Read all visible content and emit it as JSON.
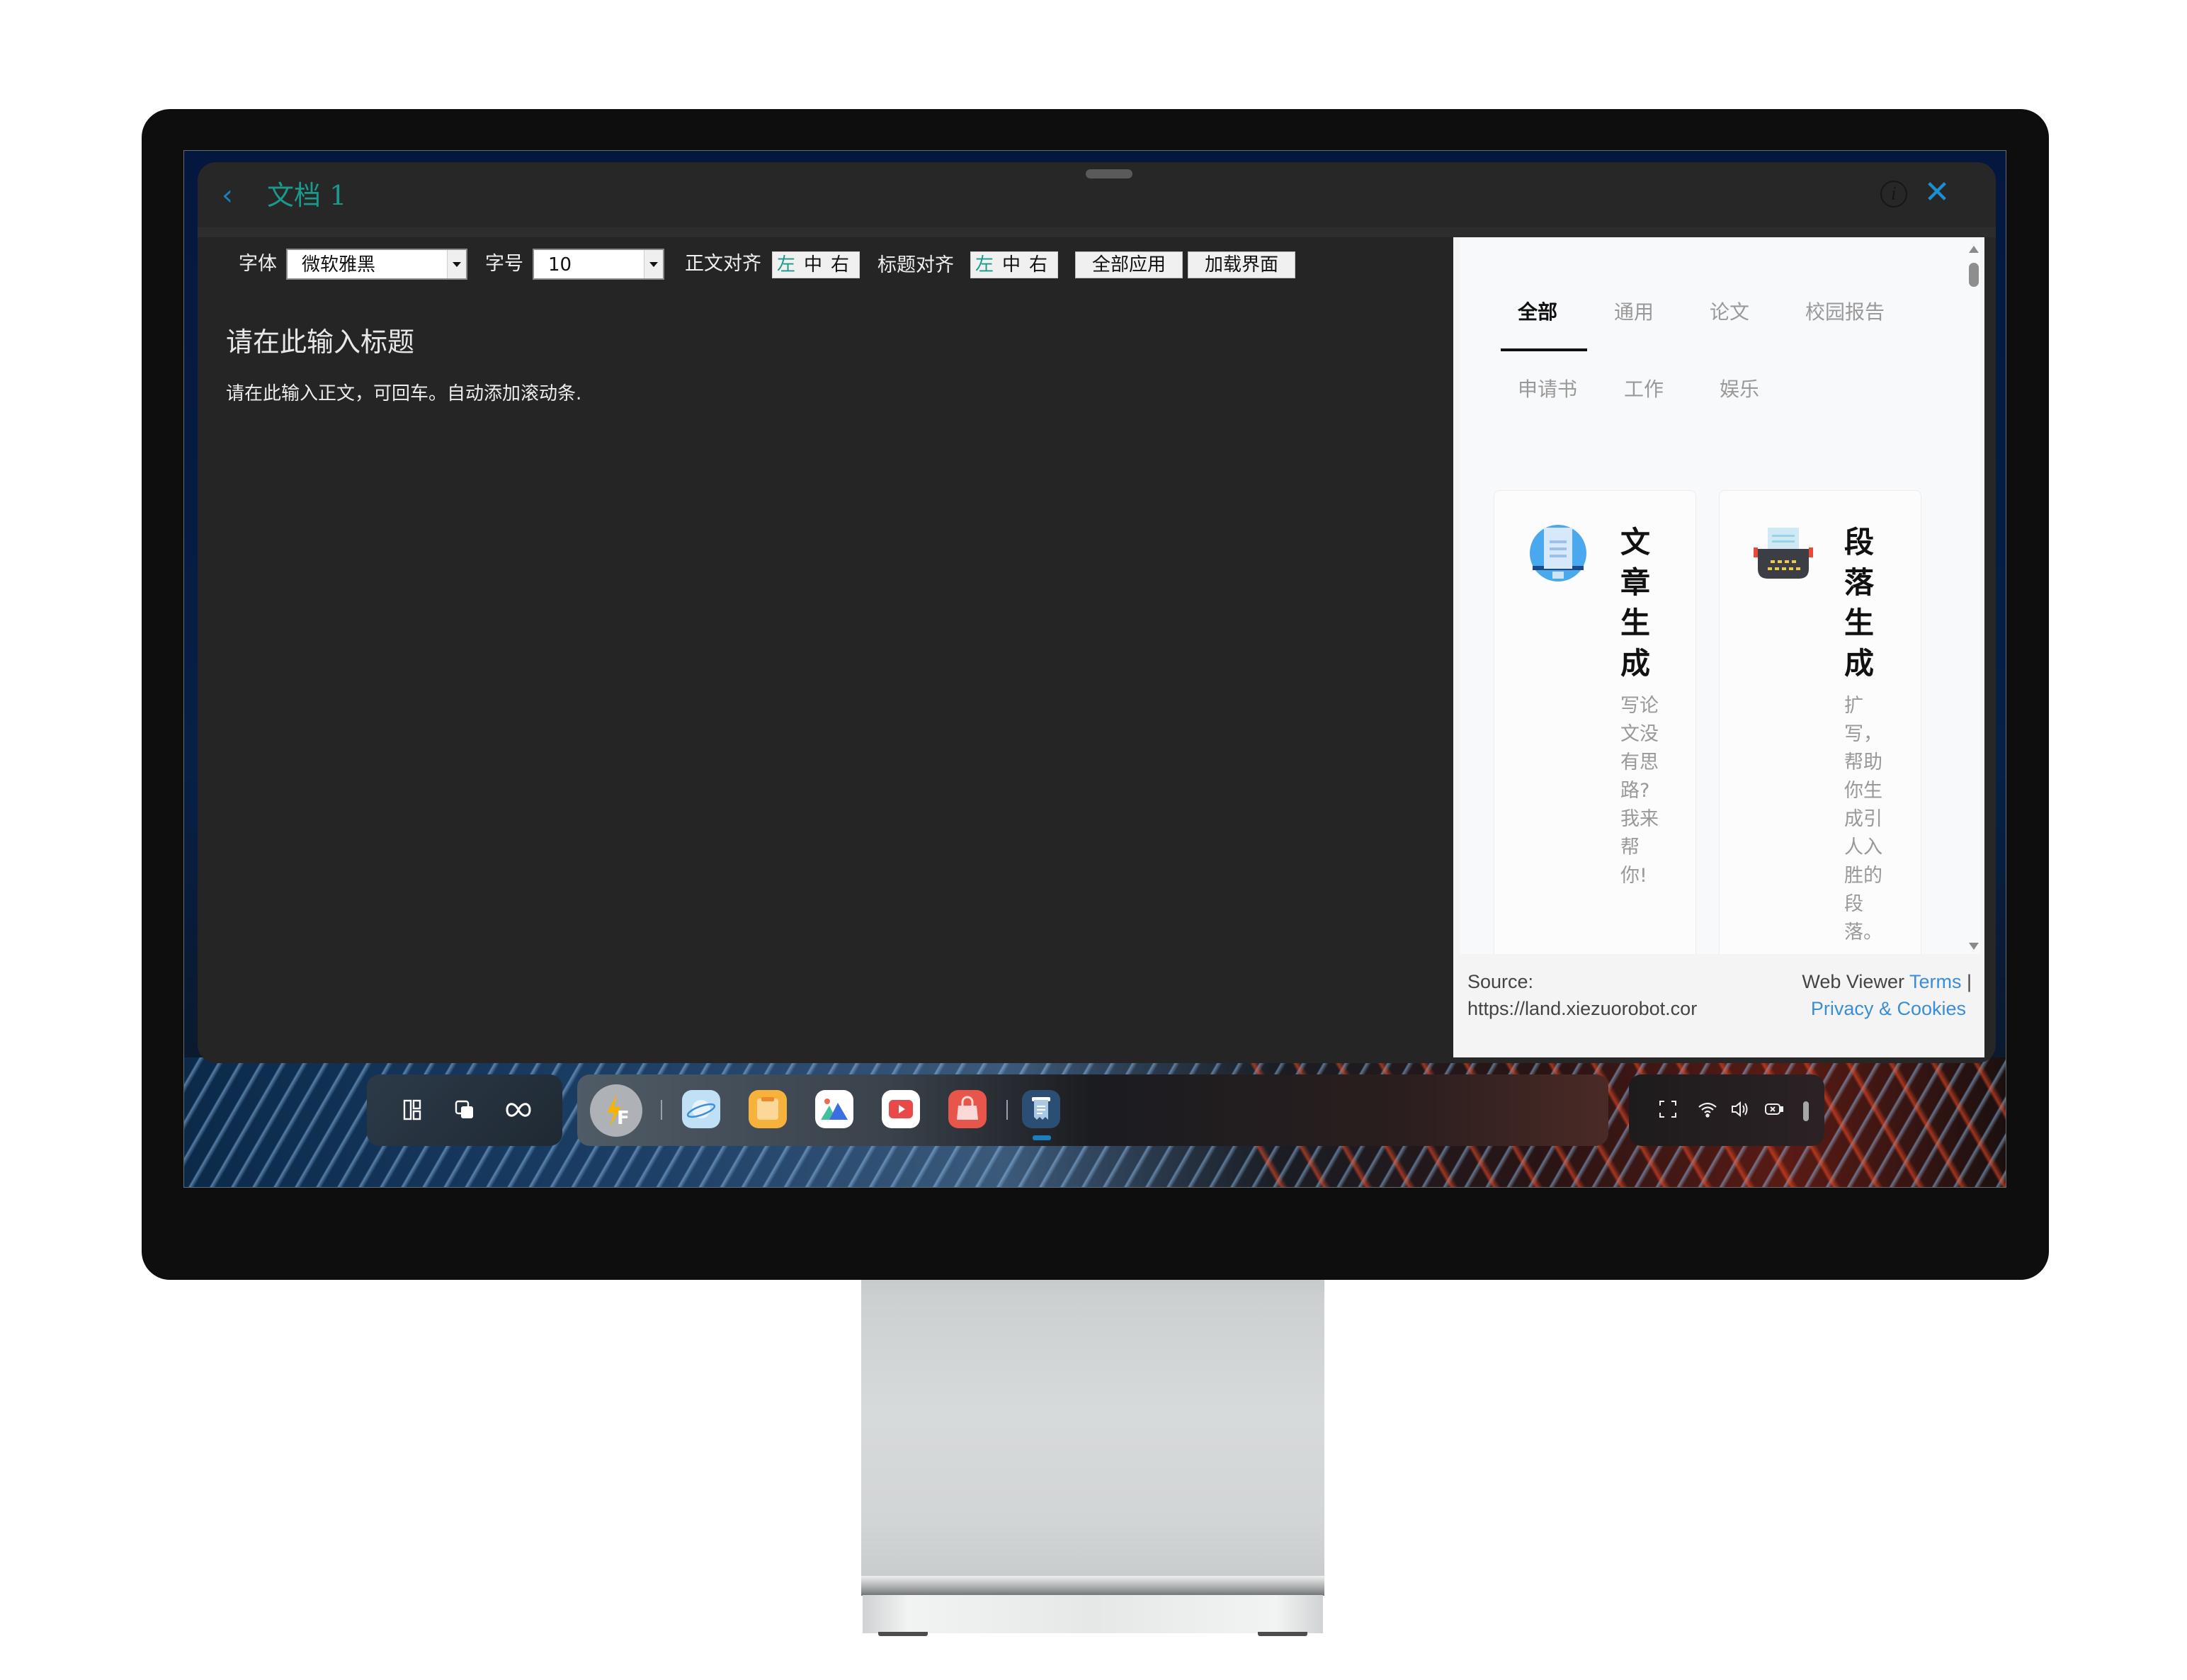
{
  "window": {
    "title": "文档 1",
    "back_icon": "‹",
    "info_icon": "i",
    "close_icon": "✕"
  },
  "toolbar": {
    "font_label": "字体",
    "font_value": "微软雅黑",
    "size_label": "字号",
    "size_value": "10",
    "body_align_label": "正文对齐",
    "title_align_label": "标题对齐",
    "align_options": [
      "左",
      "中",
      "右"
    ],
    "body_align_selected": "左",
    "title_align_selected": "左",
    "apply_all_label": "全部应用",
    "load_ui_label": "加载界面"
  },
  "editor": {
    "heading_placeholder": "请在此输入标题",
    "body_placeholder": "请在此输入正文，可回车。自动添加滚动条."
  },
  "webview": {
    "tabs": [
      {
        "label": "全部",
        "active": true
      },
      {
        "label": "通用",
        "active": false
      },
      {
        "label": "论文",
        "active": false
      },
      {
        "label": "校园报告",
        "active": false
      },
      {
        "label": "申请书",
        "active": false
      },
      {
        "label": "工作",
        "active": false
      },
      {
        "label": "娱乐",
        "active": false
      }
    ],
    "cards": [
      {
        "title": "文章生成",
        "description": "写论文没有思路?我来帮你!",
        "icon": "monitor-document-icon"
      },
      {
        "title": "段落生成",
        "description": "扩写，帮助你生成引人入胜的段落。",
        "icon": "typewriter-icon"
      }
    ],
    "footer": {
      "source_label": "Source:",
      "source_url": "https://land.xiezuorobot.cor",
      "viewer_label": "Web Viewer",
      "terms_link": "Terms",
      "divider": "|",
      "privacy_link": "Privacy & Cookies"
    }
  },
  "taskbar": {
    "left_icons": [
      "layout-icon",
      "window-switch-icon",
      "infinity-icon"
    ],
    "apps": [
      {
        "name": "fast-app",
        "icon": "lightning-f-icon",
        "color": "#aeb2b6"
      },
      {
        "name": "browser",
        "icon": "planet-icon",
        "color": "#bfe0f5"
      },
      {
        "name": "files",
        "icon": "folder-icon",
        "color": "#f7b23b"
      },
      {
        "name": "gallery",
        "icon": "mountain-image-icon",
        "color": "#ffffff"
      },
      {
        "name": "video",
        "icon": "play-icon",
        "color": "#ffffff"
      },
      {
        "name": "store",
        "icon": "shopping-bag-icon",
        "color": "#e8554b"
      },
      {
        "name": "document-app",
        "icon": "receipt-document-icon",
        "color": "#2a4f72",
        "active": true
      }
    ],
    "active_indicator_color": "#1b7fbf",
    "system_icons": [
      "fullscreen-icon",
      "wifi-icon",
      "volume-icon",
      "screen-record-off-icon"
    ]
  },
  "colors": {
    "accent_teal": "#1a9a8c",
    "accent_blue": "#1b8fcf",
    "link_blue": "#3a8ed6"
  }
}
